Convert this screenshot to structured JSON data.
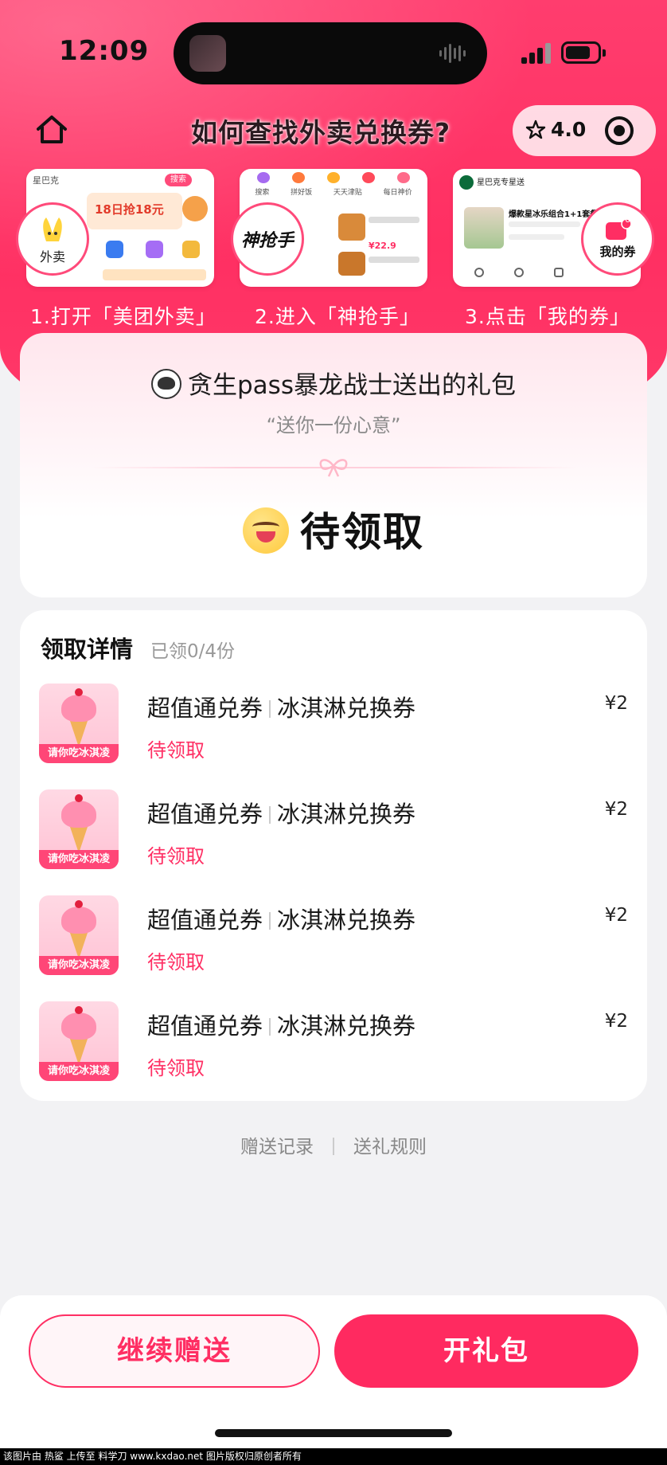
{
  "status_bar": {
    "time": "12:09"
  },
  "header": {
    "title": "如何查找外卖兑换券?",
    "rating": "4.0"
  },
  "steps": [
    {
      "label": "1.打开「美团外卖」",
      "badge": "外卖",
      "screen_search": "星巴克",
      "screen_btn": "搜索",
      "screen_promo": "18日抢18元"
    },
    {
      "label": "2.进入「神抢手」",
      "badge": "神抢手",
      "screen_tab1": "搜索",
      "screen_tab2": "拼好饭",
      "screen_tab3": "天天津贴",
      "screen_tab4": "每日神价",
      "screen_price": "¥22.9"
    },
    {
      "label": "3.点击「我的券」",
      "badge": "我的券",
      "badge_count": "6",
      "screen_title": "星巴克专星送",
      "screen_item": "爆款星冰乐组合1+1套餐"
    }
  ],
  "gift": {
    "sender_line": "贪生pass暴龙战士送出的礼包",
    "message": "“送你一份心意”",
    "status": "待领取"
  },
  "details": {
    "title": "领取详情",
    "count": "已领0/4份",
    "vouchers": [
      {
        "brand": "超值通兑券",
        "name": "冰淇淋兑换券",
        "status": "待领取",
        "price": "¥2",
        "tag": "请你吃冰淇凌"
      },
      {
        "brand": "超值通兑券",
        "name": "冰淇淋兑换券",
        "status": "待领取",
        "price": "¥2",
        "tag": "请你吃冰淇凌"
      },
      {
        "brand": "超值通兑券",
        "name": "冰淇淋兑换券",
        "status": "待领取",
        "price": "¥2",
        "tag": "请你吃冰淇凌"
      },
      {
        "brand": "超值通兑券",
        "name": "冰淇淋兑换券",
        "status": "待领取",
        "price": "¥2",
        "tag": "请你吃冰淇凌"
      }
    ]
  },
  "footer": {
    "record_link": "赠送记录",
    "rules_link": "送礼规则"
  },
  "actions": {
    "continue_label": "继续赠送",
    "open_label": "开礼包"
  },
  "watermark": "该图片由 热鲨 上传至 料学刀 www.kxdao.net 图片版权归原创者所有",
  "colors": {
    "accent": "#ff2e63",
    "hero": "#ff3d6e"
  }
}
